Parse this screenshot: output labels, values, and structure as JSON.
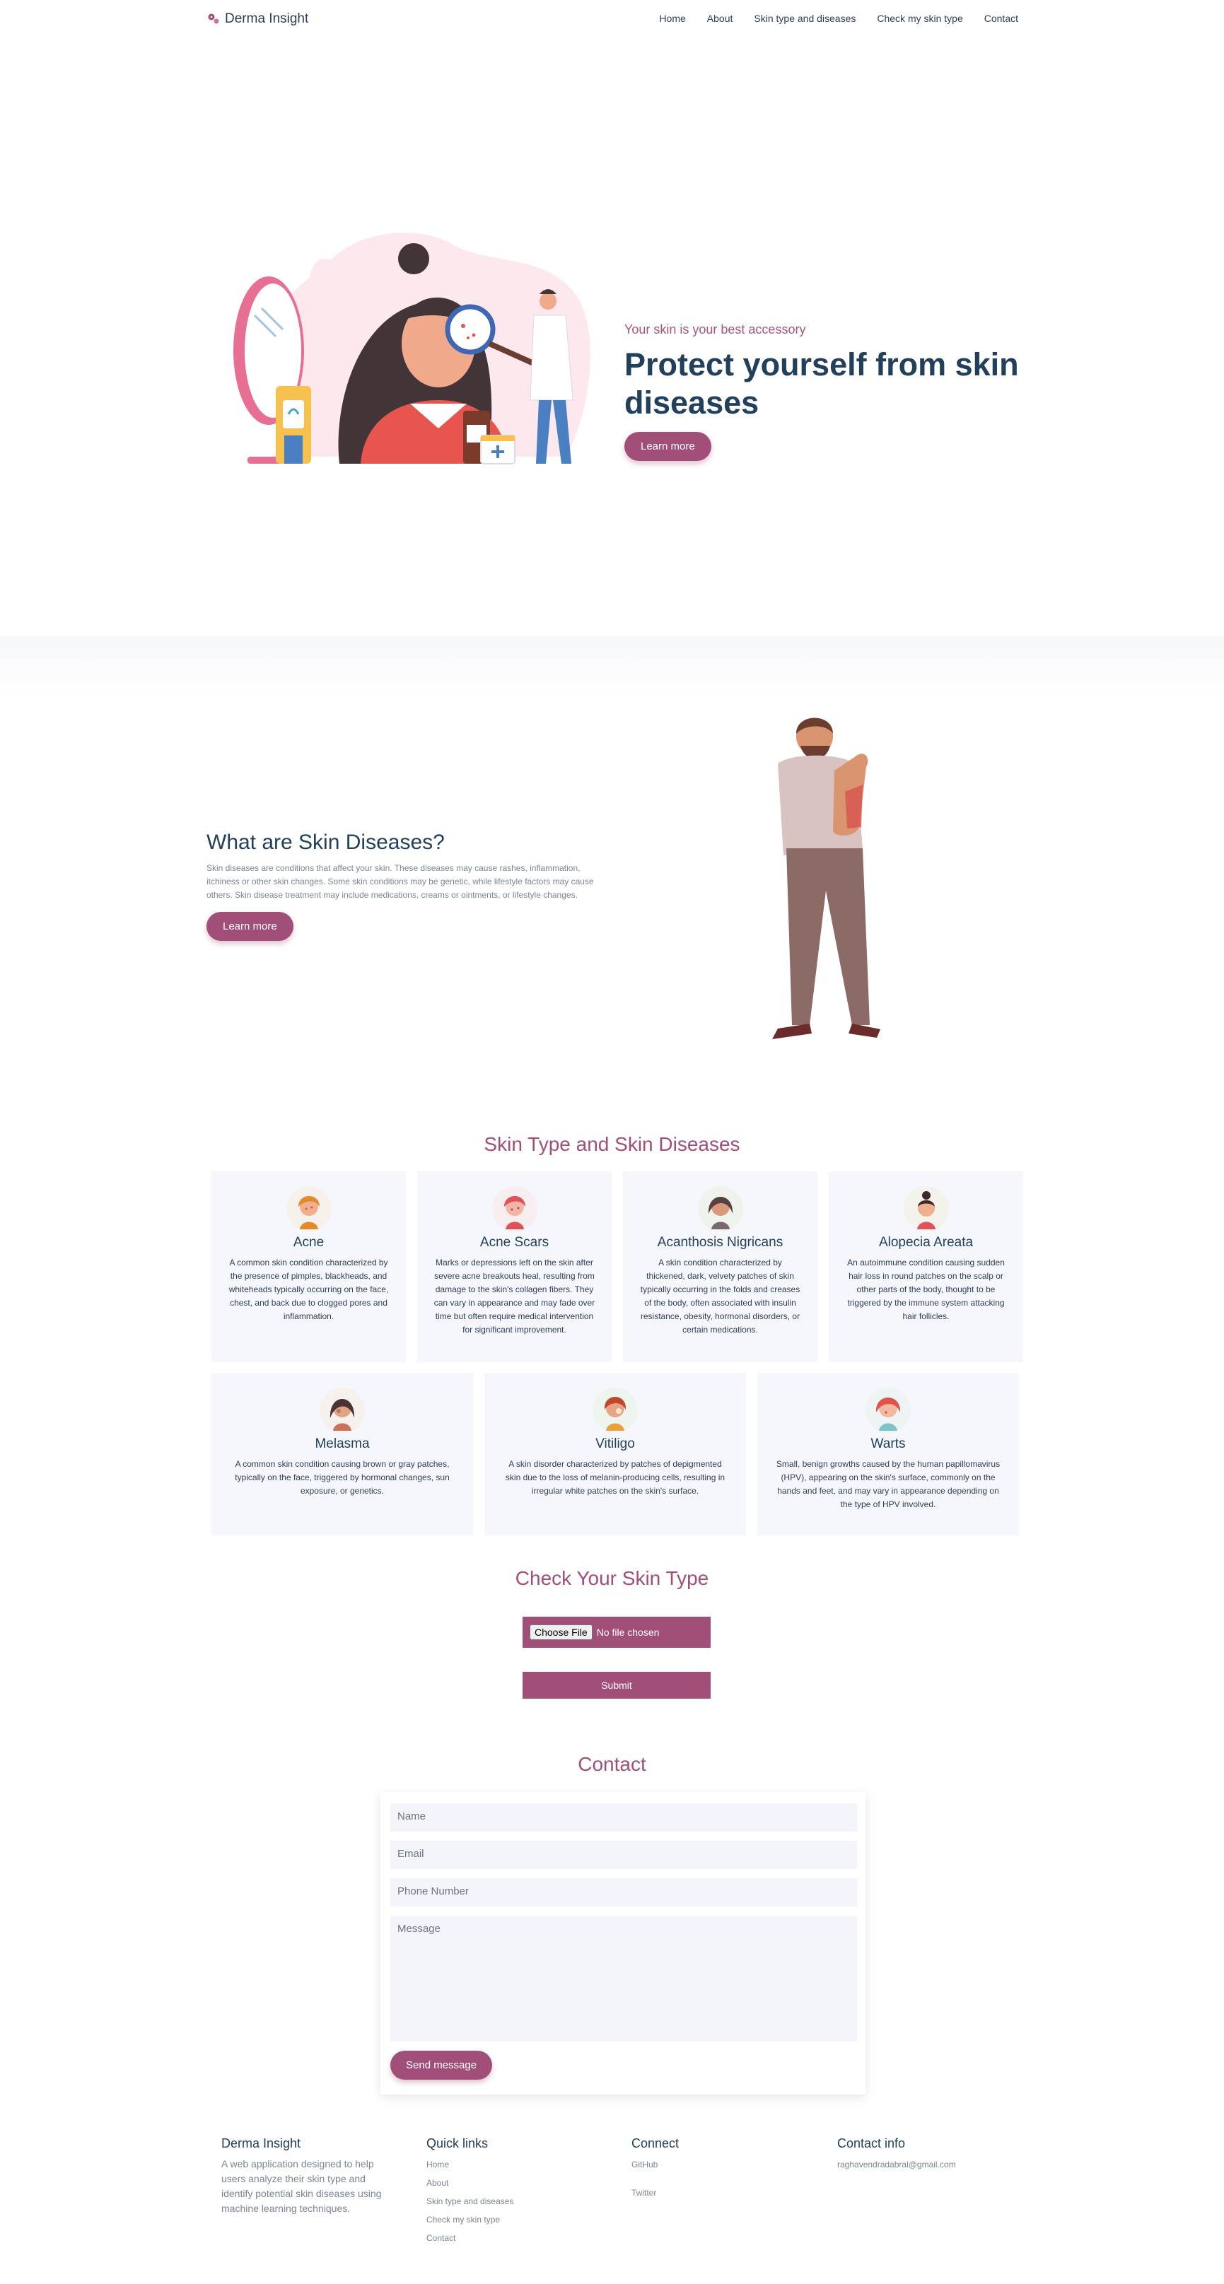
{
  "nav": {
    "brand": "Derma Insight",
    "links": [
      "Home",
      "About",
      "Skin type and diseases",
      "Check my skin type",
      "Contact"
    ]
  },
  "hero": {
    "kicker": "Your skin is your best accessory",
    "title": "Protect yourself from skin diseases",
    "button": "Learn more"
  },
  "about": {
    "title": "What are Skin Diseases?",
    "body": "Skin diseases are conditions that affect your skin. These diseases may cause rashes, inflammation, itchiness or other skin changes. Some skin conditions may be genetic, while lifestyle factors may cause others. Skin disease treatment may include medications, creams or ointments, or lifestyle changes.",
    "button": "Learn more"
  },
  "skin_types": {
    "title": "Skin Type and Skin Diseases",
    "cards": [
      {
        "title": "Acne",
        "desc": "A common skin condition characterized by the presence of pimples, blackheads, and whiteheads typically occurring on the face, chest, and back due to clogged pores and inflammation."
      },
      {
        "title": "Acne Scars",
        "desc": "Marks or depressions left on the skin after severe acne breakouts heal, resulting from damage to the skin's collagen fibers. They can vary in appearance and may fade over time but often require medical intervention for significant improvement."
      },
      {
        "title": "Acanthosis Nigricans",
        "desc": "A skin condition characterized by thickened, dark, velvety patches of skin typically occurring in the folds and creases of the body, often associated with insulin resistance, obesity, hormonal disorders, or certain medications."
      },
      {
        "title": "Alopecia Areata",
        "desc": "An autoimmune condition causing sudden hair loss in round patches on the scalp or other parts of the body, thought to be triggered by the immune system attacking hair follicles."
      },
      {
        "title": "Melasma",
        "desc": "A common skin condition causing brown or gray patches, typically on the face, triggered by hormonal changes, sun exposure, or genetics."
      },
      {
        "title": "Vitiligo",
        "desc": "A skin disorder characterized by patches of depigmented skin due to the loss of melanin-producing cells, resulting in irregular white patches on the skin's surface."
      },
      {
        "title": "Warts",
        "desc": "Small, benign growths caused by the human papillomavirus (HPV), appearing on the skin's surface, commonly on the hands and feet, and may vary in appearance depending on the type of HPV involved."
      }
    ]
  },
  "check": {
    "title": "Check Your Skin Type",
    "choose_file": "Choose File",
    "no_file": "No file chosen",
    "submit": "Submit"
  },
  "contact": {
    "title": "Contact",
    "name_placeholder": "Name",
    "email_placeholder": "Email",
    "phone_placeholder": "Phone Number",
    "message_placeholder": "Message",
    "send": "Send message"
  },
  "footer": {
    "about_head": "Derma Insight",
    "about_text": "A web application designed to help users analyze their skin type and identify potential skin diseases using machine learning techniques.",
    "quick_head": "Quick links",
    "quick_links": [
      "Home",
      "About",
      "Skin type and diseases",
      "Check my skin type",
      "Contact"
    ],
    "connect_head": "Connect",
    "connect_links": [
      "GitHub",
      "Twitter"
    ],
    "info_head": "Contact info",
    "email": "raghavendradabral@gmail.com"
  },
  "colors": {
    "accent": "#a14f79",
    "heading": "#22405c",
    "card_bg": "#f6f7fc"
  }
}
